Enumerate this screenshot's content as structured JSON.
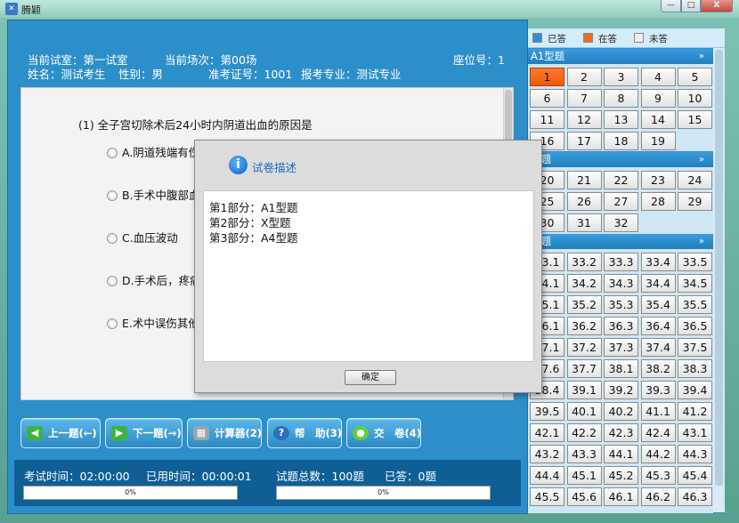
{
  "window": {
    "title": "腾颖",
    "min": "—",
    "max": "□",
    "close": "X"
  },
  "header": {
    "room": "当前试室：第一试室",
    "session": "当前场次：第00场",
    "seat": "座位号：1",
    "name": "姓名：测试考生",
    "gender": "性别：男",
    "ticket": "准考证号：1001",
    "major": "报考专业：测试专业"
  },
  "question": {
    "text": "(1) 全子宫切除术后24小时内阴道出血的原因是",
    "options": [
      "A.阴道残端有伤",
      "B.手术中腹部血",
      "C.血压波动",
      "D.手术后，疼痛",
      "E.术中误伤其他"
    ]
  },
  "nav": {
    "prev": "上一题(←)",
    "next": "下一题(→)",
    "calc": "计算器(2)",
    "help": "帮　助(3)",
    "submit": "交　卷(4)"
  },
  "status": {
    "exam_time": "考试时间：02:00:00",
    "used_time": "已用时间：00:00:01",
    "total": "试题总数：100题",
    "answered": "已答：0题",
    "progress1": "0%",
    "progress2": "0%"
  },
  "legend": {
    "answered": "已答",
    "answering": "在答",
    "unanswered": "未答",
    "answered_color": "#2f8fd6",
    "answering_color": "#f26a1b",
    "unanswered_color": "#eeeeee"
  },
  "sections": [
    {
      "title": "A1型题",
      "chevron": "»"
    },
    {
      "title": "型题",
      "chevron": "»"
    },
    {
      "title": "型题",
      "chevron": "»"
    }
  ],
  "grid1": [
    "1",
    "2",
    "3",
    "4",
    "5",
    "6",
    "7",
    "8",
    "9",
    "10",
    "11",
    "12",
    "13",
    "14",
    "15",
    "16",
    "17",
    "18",
    "19"
  ],
  "grid2": [
    "20",
    "21",
    "22",
    "23",
    "24",
    "25",
    "26",
    "27",
    "28",
    "29",
    "30",
    "31",
    "32"
  ],
  "grid3": [
    "33.1",
    "33.2",
    "33.3",
    "33.4",
    "33.5",
    "34.1",
    "34.2",
    "34.3",
    "34.4",
    "34.5",
    "35.1",
    "35.2",
    "35.3",
    "35.4",
    "35.5",
    "36.1",
    "36.2",
    "36.3",
    "36.4",
    "36.5",
    "37.1",
    "37.2",
    "37.3",
    "37.4",
    "37.5",
    "37.6",
    "37.7",
    "38.1",
    "38.2",
    "38.3",
    "38.4",
    "39.1",
    "39.2",
    "39.3",
    "39.4",
    "39.5",
    "40.1",
    "40.2",
    "41.1",
    "41.2",
    "42.1",
    "42.2",
    "42.3",
    "42.4",
    "43.1",
    "43.2",
    "43.3",
    "44.1",
    "44.2",
    "44.3",
    "44.4",
    "45.1",
    "45.2",
    "45.3",
    "45.4",
    "45.5",
    "45.6",
    "46.1",
    "46.2",
    "46.3"
  ],
  "dialog": {
    "title": "试卷描述",
    "lines": [
      "第1部分：A1型题",
      "第2部分：X型题",
      "第3部分：A4型题"
    ],
    "ok": "确定"
  }
}
